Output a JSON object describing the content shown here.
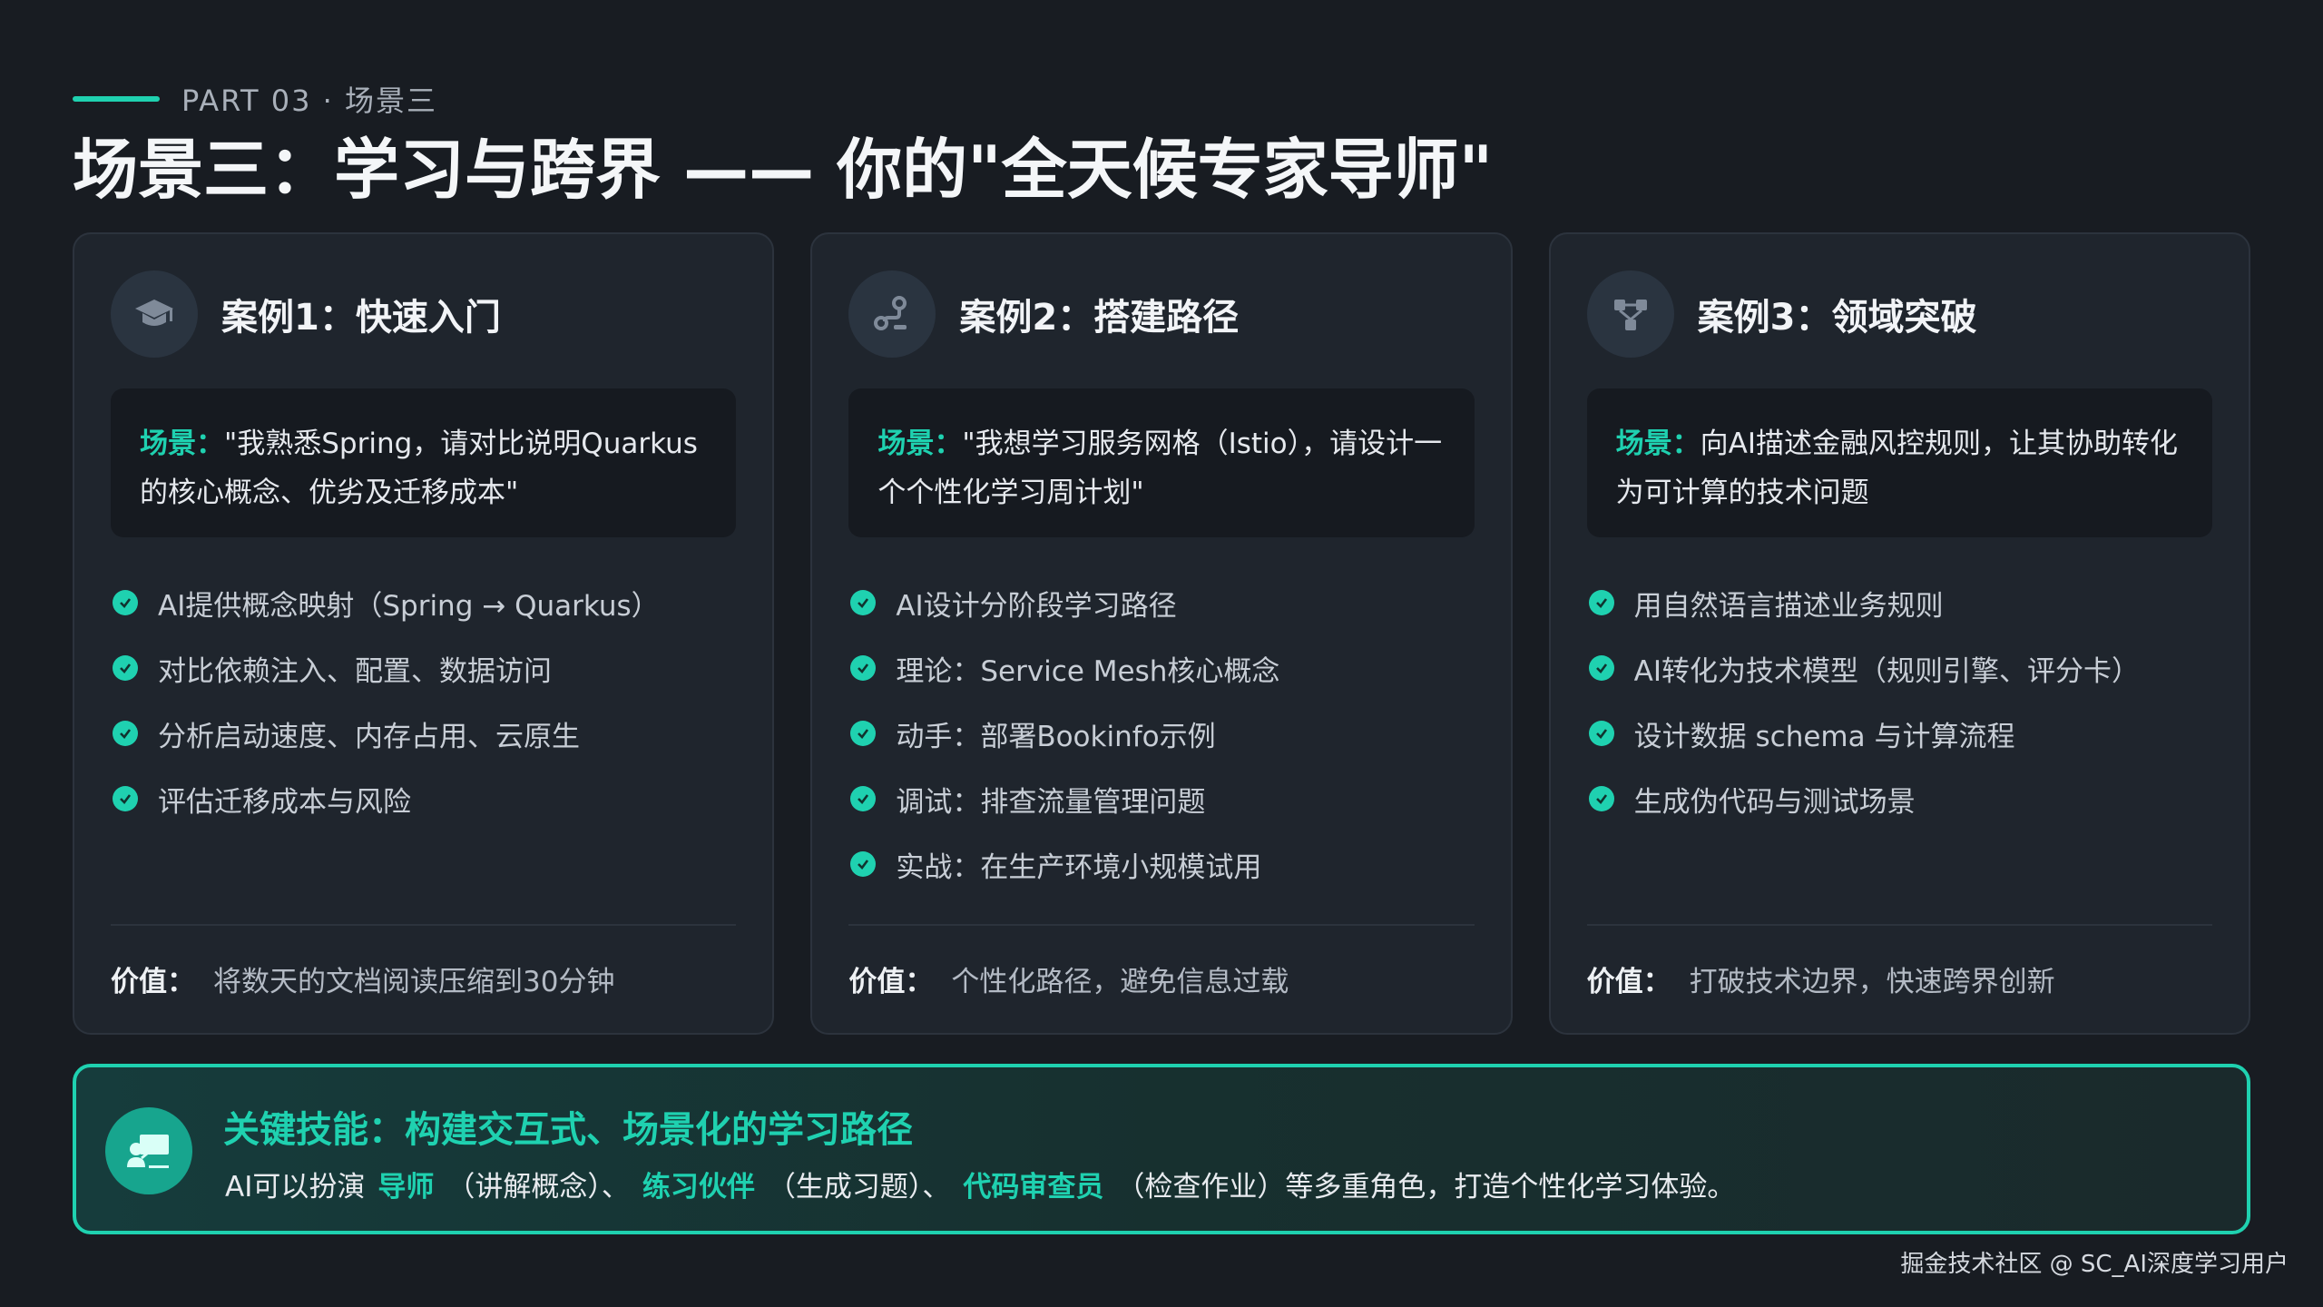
{
  "header": {
    "part_label": "PART 03 · 场景三",
    "title": "场景三：学习与跨界 —— 你的\"全天候专家导师\""
  },
  "cards": [
    {
      "icon": "graduation-cap-icon",
      "title": "案例1：快速入门",
      "scene_label": "场景：",
      "scene_text": "\"我熟悉Spring，请对比说明Quarkus的核心概念、优劣及迁移成本\"",
      "bullets": [
        "AI提供概念映射（Spring → Quarkus）",
        "对比依赖注入、配置、数据访问",
        "分析启动速度、内存占用、云原生",
        "评估迁移成本与风险"
      ],
      "value_label": "价值：",
      "value_text": "将数天的文档阅读压缩到30分钟"
    },
    {
      "icon": "route-icon",
      "title": "案例2：搭建路径",
      "scene_label": "场景：",
      "scene_text": "\"我想学习服务网格（Istio），请设计一个个性化学习周计划\"",
      "bullets": [
        "AI设计分阶段学习路径",
        "理论：Service Mesh核心概念",
        "动手：部署Bookinfo示例",
        "调试：排查流量管理问题",
        "实战：在生产环境小规模试用"
      ],
      "value_label": "价值：",
      "value_text": "个性化路径，避免信息过载"
    },
    {
      "icon": "network-nodes-icon",
      "title": "案例3：领域突破",
      "scene_label": "场景：",
      "scene_text": "向AI描述金融风控规则，让其协助转化为可计算的技术问题",
      "bullets": [
        "用自然语言描述业务规则",
        "AI转化为技术模型（规则引擎、评分卡）",
        "设计数据 schema 与计算流程",
        "生成伪代码与测试场景"
      ],
      "value_label": "价值：",
      "value_text": "打破技术边界，快速跨界创新"
    }
  ],
  "skill": {
    "icon": "teacher-board-icon",
    "title": "关键技能：构建交互式、场景化的学习路径",
    "desc_1": "AI可以扮演",
    "role_1": "导师",
    "desc_2": "（讲解概念）、",
    "role_2": "练习伙伴",
    "desc_3": "（生成习题）、",
    "role_3": "代码审查员",
    "desc_4": "（检查作业）等多重角色，打造个性化学习体验。"
  },
  "footer": "掘金技术社区 @ SC_AI深度学习用户",
  "colors": {
    "accent": "#1fd1b0",
    "background": "#181c22",
    "card": "#1f252d"
  }
}
